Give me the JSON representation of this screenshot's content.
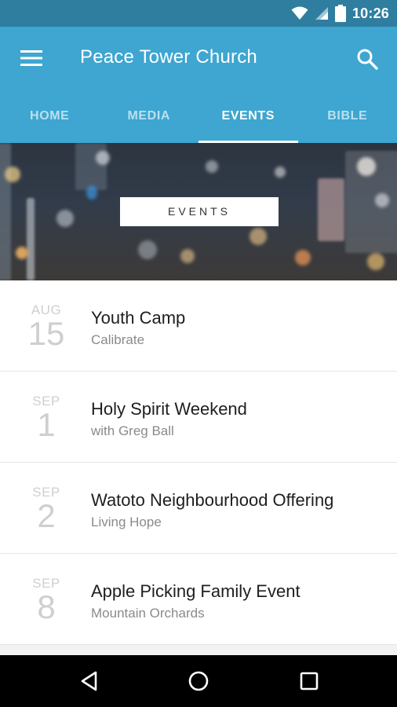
{
  "status_bar": {
    "time": "10:26"
  },
  "app_bar": {
    "title": "Peace Tower Church"
  },
  "tabs": [
    {
      "label": "HOME"
    },
    {
      "label": "MEDIA"
    },
    {
      "label": "EVENTS",
      "active": true
    },
    {
      "label": "BIBLE"
    }
  ],
  "hero": {
    "label": "EVENTS"
  },
  "events": [
    {
      "month": "AUG",
      "day": "15",
      "title": "Youth Camp",
      "subtitle": "Calibrate"
    },
    {
      "month": "SEP",
      "day": "1",
      "title": "Holy Spirit Weekend",
      "subtitle": "with Greg Ball"
    },
    {
      "month": "SEP",
      "day": "2",
      "title": "Watoto Neighbourhood Offering",
      "subtitle": "Living Hope"
    },
    {
      "month": "SEP",
      "day": "8",
      "title": "Apple Picking Family Event",
      "subtitle": "Mountain Orchards"
    }
  ],
  "colors": {
    "accent": "#3ea6d0",
    "status_bar": "#2f7ea0",
    "nav_bar": "#000000"
  },
  "icons": [
    "wifi-icon",
    "signal-icon",
    "battery-icon",
    "menu-icon",
    "search-icon",
    "back-icon",
    "home-icon",
    "recents-icon"
  ]
}
